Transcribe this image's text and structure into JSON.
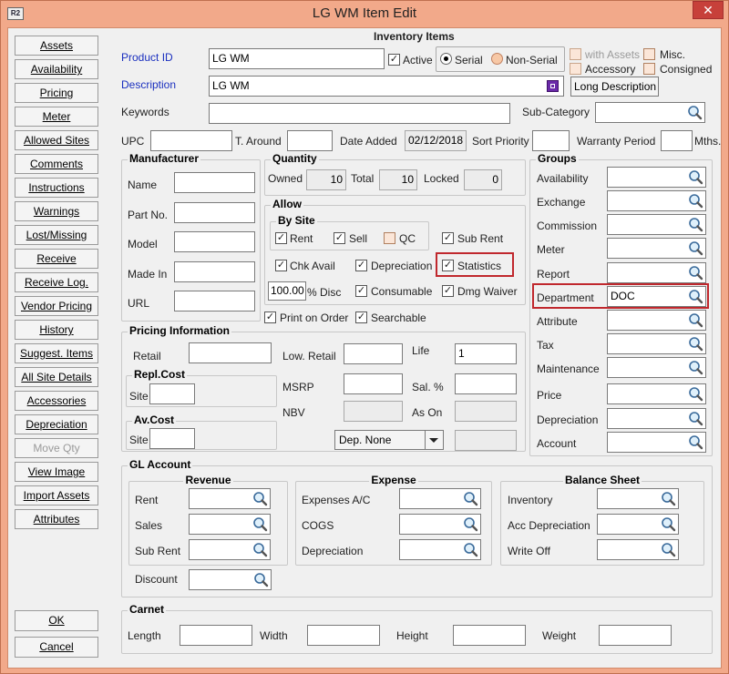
{
  "window": {
    "title": "LG WM Item Edit",
    "icon": "R2",
    "close": "✕"
  },
  "nav": [
    "Assets",
    "Availability",
    "Pricing",
    "Meter",
    "Allowed Sites",
    "Comments",
    "Instructions",
    "Warnings",
    "Lost/Missing",
    "Receive",
    "Receive Log.",
    "Vendor Pricing",
    "History",
    "Suggest. Items",
    "All Site Details",
    "Accessories",
    "Depreciation",
    "Move Qty",
    "View Image",
    "Import Assets",
    "Attributes"
  ],
  "nav_disabled": "Move Qty",
  "ok": "OK",
  "cancel": "Cancel",
  "inventory_items": "Inventory Items",
  "product_id": {
    "label": "Product ID",
    "value": "LG WM"
  },
  "description": {
    "label": "Description",
    "value": "LG WM"
  },
  "active": "Active",
  "serial": "Serial",
  "non_serial": "Non-Serial",
  "with_assets": "with Assets",
  "accessory": "Accessory",
  "misc": "Misc.",
  "consigned": "Consigned",
  "long_description": "Long Description",
  "keywords": "Keywords",
  "sub_category": "Sub-Category",
  "upc": "UPC",
  "t_around": "T. Around",
  "date_added": {
    "label": "Date Added",
    "value": "02/12/2018"
  },
  "sort_priority": "Sort Priority",
  "warranty_period": "Warranty Period",
  "mths": "Mths.",
  "manufacturer": {
    "title": "Manufacturer",
    "fields": [
      "Name",
      "Part No.",
      "Model",
      "Made In",
      "URL"
    ]
  },
  "quantity": {
    "title": "Quantity",
    "owned": "Owned",
    "owned_val": "10",
    "total": "Total",
    "total_val": "10",
    "locked": "Locked",
    "locked_val": "0"
  },
  "allow": {
    "title": "Allow",
    "by_site": "By Site",
    "rent": "Rent",
    "sell": "Sell",
    "qc": "QC",
    "sub_rent": "Sub Rent",
    "chk_avail": "Chk Avail",
    "depreciation": "Depreciation",
    "statistics": "Statistics",
    "disc_val": "100.00",
    "disc": "% Disc",
    "consumable": "Consumable",
    "dmg_waiver": "Dmg Waiver"
  },
  "print_on_order": "Print on Order",
  "searchable": "Searchable",
  "pricing": {
    "title": "Pricing Information",
    "retail": "Retail",
    "low_retail": "Low. Retail",
    "life": "Life",
    "life_val": "1",
    "repl_cost": "Repl.Cost",
    "site": "Site",
    "msrp": "MSRP",
    "sal": "Sal. %",
    "nbv": "NBV",
    "as_on": "As On",
    "av_cost": "Av.Cost",
    "dep": "Dep. None"
  },
  "groups": {
    "title": "Groups",
    "items": [
      "Availability",
      "Exchange",
      "Commission",
      "Meter",
      "Report",
      "Department",
      "Attribute",
      "Tax",
      "Maintenance",
      "Price",
      "Depreciation",
      "Account"
    ],
    "department_val": "DOC"
  },
  "gl": {
    "title": "GL Account",
    "revenue": "Revenue",
    "revenue_items": [
      "Rent",
      "Sales",
      "Sub Rent"
    ],
    "discount": "Discount",
    "expense": "Expense",
    "expense_items": [
      "Expenses A/C",
      "COGS",
      "Depreciation"
    ],
    "balance": "Balance Sheet",
    "balance_items": [
      "Inventory",
      "Acc Depreciation",
      "Write Off"
    ]
  },
  "carnet": {
    "title": "Carnet",
    "length": "Length",
    "width": "Width",
    "height": "Height",
    "weight": "Weight"
  },
  "colors": {
    "highlight": "#c0282d",
    "link": "#1a2fbf",
    "frame": "#f2a98a"
  }
}
